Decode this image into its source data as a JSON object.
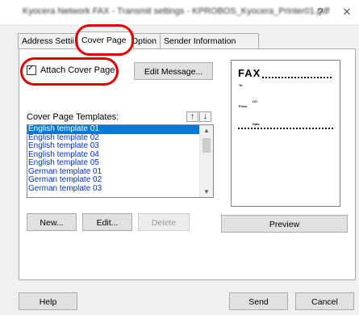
{
  "window": {
    "title": "Kyocera Network FAX - Transmit settings - KPROBOS_Kyocera_Printer01.pdf",
    "help_glyph": "?",
    "close_glyph": "✕"
  },
  "tabs": [
    {
      "label": "Address Settii",
      "active": false
    },
    {
      "label": "Cover Page",
      "active": true
    },
    {
      "label": "Option",
      "active": false
    },
    {
      "label": "Sender Information",
      "active": false
    }
  ],
  "cover": {
    "attach_label": "Attach Cover Page",
    "attach_checked": true,
    "edit_message_label": "Edit Message...",
    "templates_label": "Cover Page Templates:",
    "move_up_glyph": "↑",
    "move_down_glyph": "↓",
    "templates": [
      "English template 01",
      "English template 02",
      "English template 03",
      "English template 04",
      "English template 05",
      "German template 01",
      "German template 02",
      "German template 03"
    ],
    "selected_index": 0,
    "new_label": "New...",
    "edit_label": "Edit...",
    "delete_label": "Delete",
    "preview_label": "Preview"
  },
  "preview_doc": {
    "heading": "FAX",
    "to": "To",
    "from": "From",
    "cc": "CC",
    "date": "Date"
  },
  "footer": {
    "help_label": "Help",
    "send_label": "Send",
    "cancel_label": "Cancel"
  },
  "colors": {
    "highlight": "#e00000",
    "selection": "#0078d7",
    "list_text": "#0033cc"
  }
}
